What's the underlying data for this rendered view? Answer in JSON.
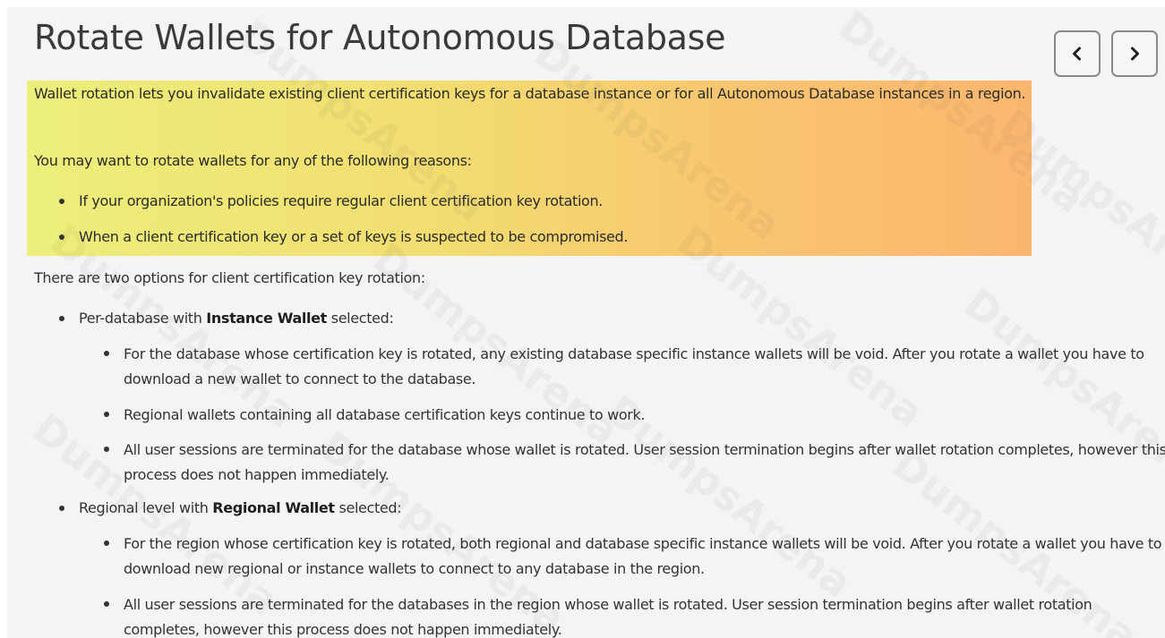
{
  "slide": {
    "title": "Rotate Wallets for Autonomous Database",
    "nav": {
      "prev_icon": "chevron-left-icon",
      "next_icon": "chevron-right-icon"
    },
    "highlight_colors": [
      "#ecef7a",
      "#f8c470",
      "#fbb66e"
    ],
    "intro": "Wallet rotation lets you invalidate existing client certification keys for a database instance or for all Autonomous Database instances in a region.",
    "reasons_intro": "You may want to rotate wallets for any of the following reasons:",
    "reasons": [
      "If your organization's policies require regular client certification key rotation.",
      "When a client certification key or a set of keys is suspected to be compromised."
    ],
    "options_intro": "There are two options for client certification key rotation:",
    "options": [
      {
        "prefix": "Per-database with ",
        "bold": "Instance Wallet",
        "suffix": " selected:",
        "details": [
          "For the database whose certification key is rotated, any existing database specific instance wallets will be void. After you rotate a wallet you have to download a new wallet to connect to the database.",
          "Regional wallets containing all database certification keys continue to work.",
          "All user sessions are terminated for the database whose wallet is rotated. User session termination begins after wallet rotation completes, however this process does not happen immediately."
        ]
      },
      {
        "prefix": "Regional level with ",
        "bold": "Regional Wallet",
        "suffix": " selected:",
        "details": [
          "For the region whose certification key is rotated, both regional and database specific instance wallets will be void. After you rotate a wallet you have to download new regional or instance wallets to connect to any database in the region.",
          "All user sessions are terminated for the databases in the region whose wallet is rotated. User session termination begins after wallet rotation completes, however this process does not happen immediately."
        ]
      }
    ]
  },
  "watermark": {
    "text": "DumpsArena"
  }
}
